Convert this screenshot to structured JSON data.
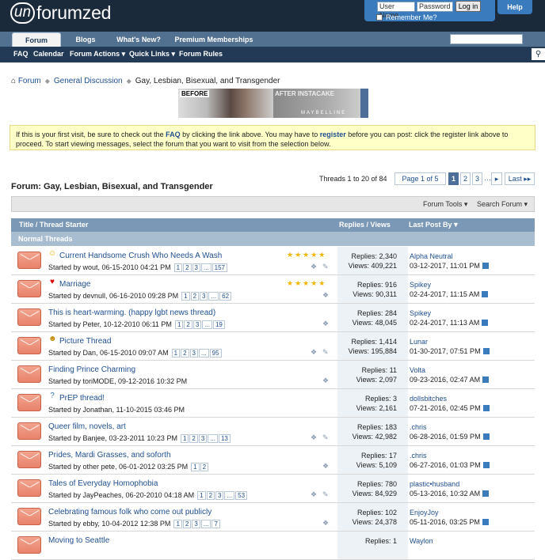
{
  "site": {
    "logo_un": "un",
    "logo_rest": "forumzed"
  },
  "login": {
    "user_placeholder": "User Name",
    "pass_placeholder": "Password",
    "button": "Log in",
    "remember": "Remember Me?",
    "help": "Help"
  },
  "tabs": [
    "Forum",
    "Blogs",
    "What's New?",
    "Premium Memberships"
  ],
  "subnav": [
    "FAQ",
    "Calendar",
    "Forum Actions ▾",
    "Quick Links ▾",
    "Forum Rules"
  ],
  "breadcrumb": [
    "Forum",
    "General Discussion",
    "Gay, Lesbian, Bisexual, and Transgender"
  ],
  "ad": {
    "before": "BEFORE",
    "after": "AFTER INSTACAKE",
    "brand": "MAYBELLINE"
  },
  "notice": {
    "t1": "If this is your first visit, be sure to check out the ",
    "faq": "FAQ",
    "t2": " by clicking the link above. You may have to ",
    "register": "register",
    "t3": " before you can post: click the register link above to proceed. To start viewing messages, select the forum that you want to visit from the selection below."
  },
  "pagination": {
    "label": "Threads 1 to 20 of 84",
    "page_of": "Page 1 of 5",
    "pages": [
      "1",
      "2",
      "3",
      "…",
      "▸"
    ],
    "last": "Last ▸▸"
  },
  "forum_title": "Forum: Gay, Lesbian, Bisexual, and Transgender",
  "tools": {
    "forum_tools": "Forum Tools ▾",
    "search_forum": "Search Forum ▾"
  },
  "columns": {
    "title": "Title / Thread Starter",
    "replies": "Replies / Views",
    "lastpost": "Last Post By"
  },
  "section": "Normal Threads",
  "threads": [
    {
      "icon": "☺",
      "title": "Current Handsome Crush Who Needs A Wash",
      "starter": "Started by wout, 06-15-2010 04:21 PM",
      "pages": [
        "1",
        "2",
        "3",
        "...",
        "157"
      ],
      "stars": "★★★★★",
      "replies": "Replies: 2,340",
      "views": "Views: 409,221",
      "last_user": "Alpha Neutral",
      "last_date": "03-12-2017, 11:01 PM"
    },
    {
      "icon": "♥",
      "title": "Marriage",
      "starter": "Started by devnull, 06-16-2010 09:28 PM",
      "pages": [
        "1",
        "2",
        "3",
        "...",
        "62"
      ],
      "stars": "★★★★★",
      "replies": "Replies: 916",
      "views": "Views: 90,311",
      "last_user": "Spikey",
      "last_date": "02-24-2017, 11:15 AM"
    },
    {
      "icon": "",
      "title": "This is heart-warming. (happy lgbt news thread)",
      "starter": "Started by Peter, 10-12-2010 06:11 PM",
      "pages": [
        "1",
        "2",
        "3",
        "...",
        "19"
      ],
      "stars": "",
      "replies": "Replies: 284",
      "views": "Views: 48,045",
      "last_user": "Spikey",
      "last_date": "02-24-2017, 11:13 AM"
    },
    {
      "icon": "☻",
      "title": "Picture Thread",
      "starter": "Started by Dan, 06-15-2010 09:07 AM",
      "pages": [
        "1",
        "2",
        "3",
        "...",
        "95"
      ],
      "stars": "",
      "replies": "Replies: 1,414",
      "views": "Views: 195,884",
      "last_user": "Lunar",
      "last_date": "01-30-2017, 07:51 PM"
    },
    {
      "icon": "",
      "title": "Finding Prince Charming",
      "starter": "Started by toriMODE, 09-12-2016 10:32 PM",
      "pages": [],
      "stars": "",
      "replies": "Replies: 11",
      "views": "Views: 2,097",
      "last_user": "Volta",
      "last_date": "09-23-2016, 02:47 AM"
    },
    {
      "icon": "?",
      "title": "PrEP thread!",
      "starter": "Started by Jonathan, 11-10-2015 03:46 PM",
      "pages": [],
      "stars": "",
      "replies": "Replies: 3",
      "views": "Views: 2,161",
      "last_user": "dollsbitches",
      "last_date": "07-21-2016, 02:45 PM"
    },
    {
      "icon": "",
      "title": "Queer film, novels, art",
      "starter": "Started by Banjee, 03-23-2011 10:23 PM",
      "pages": [
        "1",
        "2",
        "3",
        "...",
        "13"
      ],
      "stars": "",
      "replies": "Replies: 183",
      "views": "Views: 42,982",
      "last_user": ".chris",
      "last_date": "06-28-2016, 01:59 PM"
    },
    {
      "icon": "",
      "title": "Prides, Mardi Grasses, and soforth",
      "starter": "Started by other pete, 06-01-2012 03:25 PM",
      "pages": [
        "1",
        "2"
      ],
      "stars": "",
      "replies": "Replies: 17",
      "views": "Views: 5,109",
      "last_user": ".chris",
      "last_date": "06-27-2016, 01:03 PM"
    },
    {
      "icon": "",
      "title": "Tales of Everyday Homophobia",
      "starter": "Started by JayPeaches, 06-20-2010 04:18 AM",
      "pages": [
        "1",
        "2",
        "3",
        "...",
        "53"
      ],
      "stars": "",
      "replies": "Replies: 780",
      "views": "Views: 84,929",
      "last_user": "plastic•husband",
      "last_date": "05-13-2016, 10:32 AM"
    },
    {
      "icon": "",
      "title": "Celebrating famous folk who come out publicly",
      "starter": "Started by ebby, 10-04-2012 12:38 PM",
      "pages": [
        "1",
        "2",
        "3",
        "...",
        "7"
      ],
      "stars": "",
      "replies": "Replies: 102",
      "views": "Views: 24,378",
      "last_user": "EnjoyJoy",
      "last_date": "05-11-2016, 03:25 PM"
    },
    {
      "icon": "",
      "title": "Moving to Seattle",
      "starter": "",
      "pages": [],
      "stars": "",
      "replies": "Replies: 1",
      "views": "",
      "last_user": "Waylon",
      "last_date": ""
    }
  ]
}
